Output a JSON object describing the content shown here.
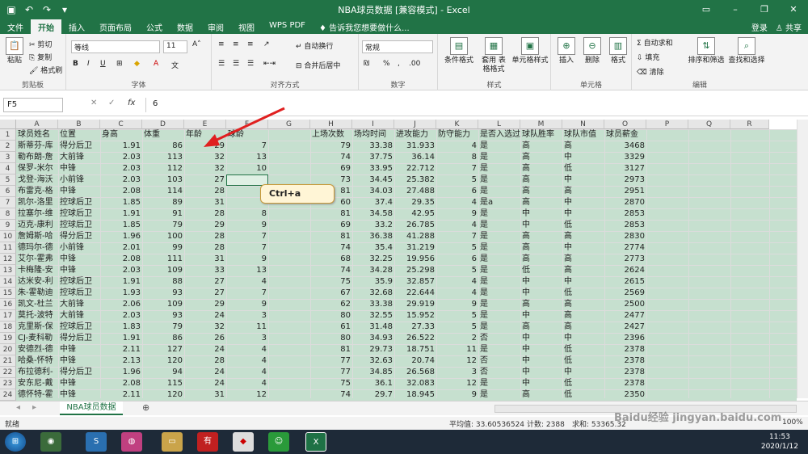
{
  "window": {
    "title": "NBA球员数据 [兼容模式] - Excel"
  },
  "ribbon_tabs": [
    "文件",
    "开始",
    "插入",
    "页面布局",
    "公式",
    "数据",
    "审阅",
    "视图",
    "WPS PDF"
  ],
  "tell_me": "告诉我您想要做什么...",
  "account": {
    "signin": "登录",
    "share": "共享"
  },
  "clipboard": {
    "paste": "粘贴",
    "cut": "剪切",
    "copy": "复制",
    "format_painter": "格式刷",
    "label": "剪贴板"
  },
  "font": {
    "name": "等线",
    "size": "11",
    "bold": "B",
    "italic": "I",
    "underline": "U",
    "label": "字体"
  },
  "align": {
    "wrap": "自动换行",
    "merge": "合并后居中",
    "label": "对齐方式"
  },
  "number": {
    "format": "常规",
    "label": "数字"
  },
  "styles": {
    "cond": "条件格式",
    "table": "套用\n表格格式",
    "cell": "单元格样式",
    "label": "样式"
  },
  "cells": {
    "insert": "插入",
    "delete": "删除",
    "format": "格式",
    "label": "单元格"
  },
  "editing": {
    "autosum": "自动求和",
    "fill": "填充",
    "clear": "清除",
    "sort": "排序和筛选",
    "find": "查找和选择",
    "label": "编辑"
  },
  "formula_bar": {
    "name_box": "F5",
    "formula": "6"
  },
  "columns": [
    "A",
    "B",
    "C",
    "D",
    "E",
    "F",
    "G",
    "H",
    "I",
    "J",
    "K",
    "L",
    "M",
    "N",
    "O",
    "P",
    "Q",
    "R"
  ],
  "left_header": [
    "球员姓名",
    "位置",
    "身高",
    "体重",
    "年龄",
    "球龄"
  ],
  "right_header": [
    "上场次数",
    "场均时间",
    "进攻能力",
    "防守能力",
    "是否入选过",
    "球队胜率",
    "球队市值",
    "球员薪金"
  ],
  "rows": [
    [
      "斯蒂芬-库",
      "得分后卫",
      "1.91",
      "86",
      "29",
      "7",
      "79",
      "33.38",
      "31.933",
      "4",
      "是",
      "高",
      "高",
      "3468"
    ],
    [
      "勒布朗-詹",
      "大前锋",
      "2.03",
      "113",
      "32",
      "13",
      "74",
      "37.75",
      "36.14",
      "8",
      "是",
      "高",
      "中",
      "3329"
    ],
    [
      "保罗-米尔",
      "中锋",
      "2.03",
      "112",
      "32",
      "10",
      "69",
      "33.95",
      "22.712",
      "7",
      "是",
      "高",
      "低",
      "3127"
    ],
    [
      "戈登-海沃",
      "小前锋",
      "2.03",
      "103",
      "27",
      "6",
      "73",
      "34.45",
      "25.382",
      "5",
      "是",
      "高",
      "中",
      "2973"
    ],
    [
      "布雷克-格",
      "中锋",
      "2.08",
      "114",
      "28",
      "",
      "81",
      "34.03",
      "27.488",
      "6",
      "是",
      "高",
      "高",
      "2951"
    ],
    [
      "凯尔-洛里",
      "控球后卫",
      "1.85",
      "89",
      "31",
      "",
      "60",
      "37.4",
      "29.35",
      "4",
      "是a",
      "高",
      "中",
      "2870"
    ],
    [
      "拉塞尔-维",
      "控球后卫",
      "1.91",
      "91",
      "28",
      "8",
      "81",
      "34.58",
      "42.95",
      "9",
      "是",
      "中",
      "中",
      "2853"
    ],
    [
      "迈克-康利",
      "控球后卫",
      "1.85",
      "79",
      "29",
      "9",
      "69",
      "33.2",
      "26.785",
      "4",
      "是",
      "中",
      "低",
      "2853"
    ],
    [
      "詹姆斯-哈",
      "得分后卫",
      "1.96",
      "100",
      "28",
      "7",
      "81",
      "36.38",
      "41.288",
      "7",
      "是",
      "高",
      "高",
      "2830"
    ],
    [
      "德玛尔-德",
      "小前锋",
      "2.01",
      "99",
      "28",
      "7",
      "74",
      "35.4",
      "31.219",
      "5",
      "是",
      "高",
      "中",
      "2774"
    ],
    [
      "艾尔-霍弗",
      "中锋",
      "2.08",
      "111",
      "31",
      "9",
      "68",
      "32.25",
      "19.956",
      "6",
      "是",
      "高",
      "高",
      "2773"
    ],
    [
      "卡梅隆-安",
      "中锋",
      "2.03",
      "109",
      "33",
      "13",
      "74",
      "34.28",
      "25.298",
      "5",
      "是",
      "低",
      "高",
      "2624"
    ],
    [
      "达米安-利",
      "控球后卫",
      "1.91",
      "88",
      "27",
      "4",
      "75",
      "35.9",
      "32.857",
      "4",
      "是",
      "中",
      "中",
      "2615"
    ],
    [
      "朱-霍勒迪",
      "控球后卫",
      "1.93",
      "93",
      "27",
      "7",
      "67",
      "32.68",
      "22.644",
      "4",
      "是",
      "中",
      "低",
      "2569"
    ],
    [
      "凯文-杜兰",
      "大前锋",
      "2.06",
      "109",
      "29",
      "9",
      "62",
      "33.38",
      "29.919",
      "9",
      "是",
      "高",
      "高",
      "2500"
    ],
    [
      "莫托-波特",
      "大前锋",
      "2.03",
      "93",
      "24",
      "3",
      "80",
      "32.55",
      "15.952",
      "5",
      "是",
      "中",
      "高",
      "2477"
    ],
    [
      "克里斯-保",
      "控球后卫",
      "1.83",
      "79",
      "32",
      "11",
      "61",
      "31.48",
      "27.33",
      "5",
      "是",
      "高",
      "高",
      "2427"
    ],
    [
      "CJ-麦科勒",
      "得分后卫",
      "1.91",
      "86",
      "26",
      "3",
      "80",
      "34.93",
      "26.522",
      "2",
      "否",
      "中",
      "中",
      "2396"
    ],
    [
      "安德烈-德",
      "中锋",
      "2.11",
      "127",
      "24",
      "4",
      "81",
      "29.73",
      "18.751",
      "11",
      "是",
      "中",
      "低",
      "2378"
    ],
    [
      "哈桑-怀特",
      "中锋",
      "2.13",
      "120",
      "28",
      "4",
      "77",
      "32.63",
      "20.74",
      "12",
      "否",
      "中",
      "低",
      "2378"
    ],
    [
      "布拉德利-",
      "得分后卫",
      "1.96",
      "94",
      "24",
      "4",
      "77",
      "34.85",
      "26.568",
      "3",
      "否",
      "中",
      "中",
      "2378"
    ],
    [
      "安东尼-戴",
      "中锋",
      "2.08",
      "115",
      "24",
      "4",
      "75",
      "36.1",
      "32.083",
      "12",
      "是",
      "中",
      "低",
      "2378"
    ],
    [
      "德怀特-霍",
      "中锋",
      "2.11",
      "120",
      "31",
      "12",
      "74",
      "29.7",
      "18.945",
      "9",
      "是",
      "高",
      "低",
      "2350"
    ]
  ],
  "callout": "Ctrl+a",
  "sheet_tab": "NBA球员数据",
  "status": {
    "ready": "就绪",
    "avg": "平均值: 33.60536524",
    "count": "计数: 2388",
    "sum": "求和: 53365.32",
    "zoom": "100%"
  },
  "clock": {
    "time": "11:53",
    "date": "2020/1/12"
  },
  "watermark": "Baidu经验  jingyan.baidu.com"
}
